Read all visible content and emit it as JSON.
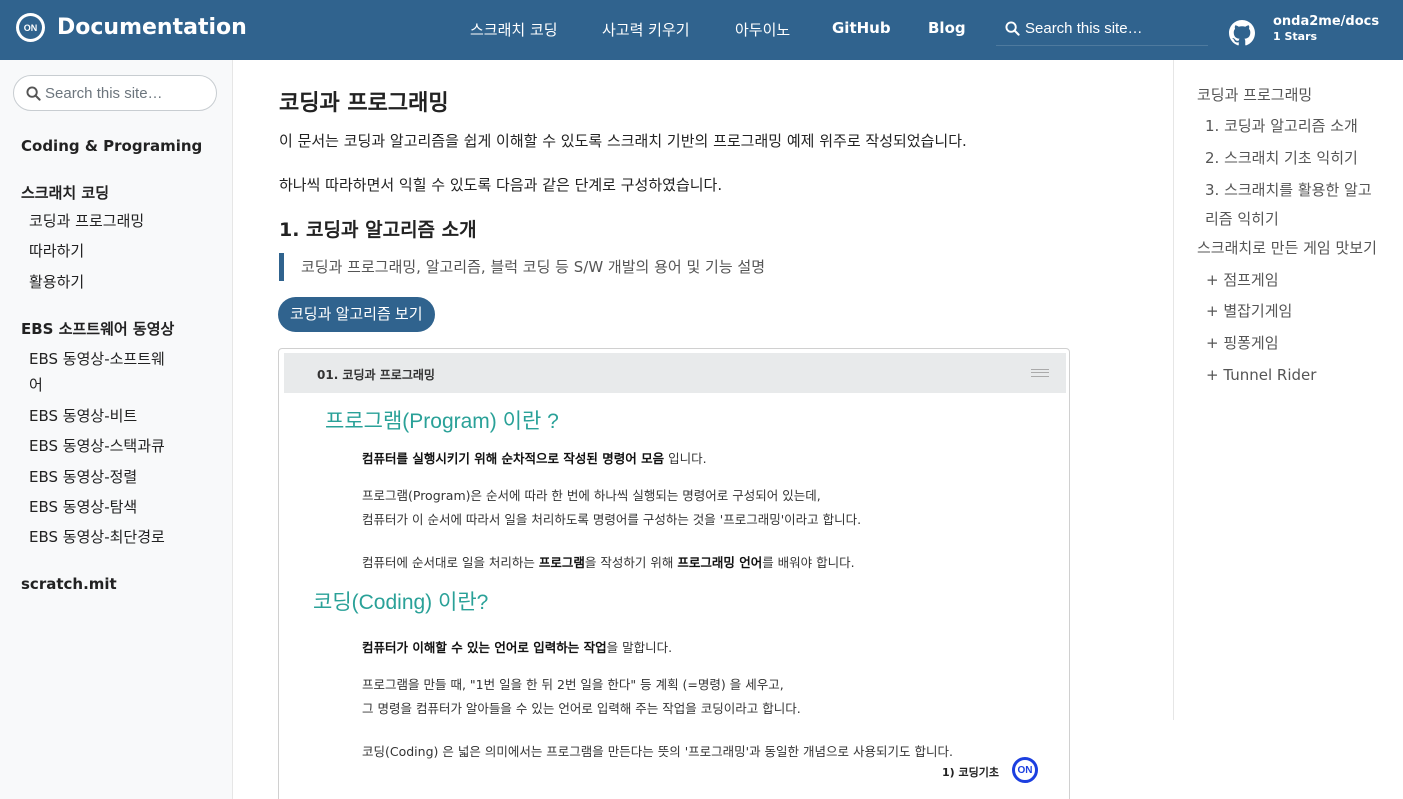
{
  "header": {
    "logo_text": "ON",
    "title": "Documentation",
    "nav": [
      "스크래치 코딩",
      "사고력 키우기",
      "아두이노",
      "GitHub",
      "Blog"
    ],
    "search_placeholder": "Search this site…",
    "repo_name": "onda2me/docs",
    "repo_stars": "1 Stars"
  },
  "sidebar": {
    "search_placeholder": "Search this site…",
    "sections": [
      {
        "title": "Coding & Programing",
        "items": []
      },
      {
        "title": "스크래치 코딩",
        "items": [
          "코딩과 프로그래밍",
          "따라하기",
          "활용하기"
        ]
      },
      {
        "title": "EBS 소프트웨어 동영상",
        "items": [
          "EBS 동영상-소프트웨어",
          "EBS 동영상-비트",
          "EBS 동영상-스택과큐",
          "EBS 동영상-정렬",
          "EBS 동영상-탐색",
          "EBS 동영상-최단경로"
        ]
      },
      {
        "title": "scratch.mit",
        "items": []
      }
    ],
    "long_item_line1": "EBS 동영상-소프트웨",
    "long_item_line2": "어"
  },
  "main": {
    "title": "코딩과 프로그래밍",
    "intro": "이 문서는 코딩과 알고리즘을 쉽게 이해할 수 있도록 스크래치 기반의 프로그래밍 예제 위주로 작성되었습니다.",
    "intro2": "하나씩 따라하면서 익힐 수 있도록 다음과 같은 단계로 구성하였습니다.",
    "section_title": "1. 코딩과 알고리즘 소개",
    "quote": "코딩과 프로그래밍, 알고리즘, 블럭 코딩 등 S/W 개발의 용어 및 기능 설명",
    "button": "코딩과 알고리즘 보기",
    "doc": {
      "header": "01. 코딩과 프로그래밍",
      "h1": "프로그램(Program) 이란 ?",
      "p1_bold": "컴퓨터를 실행시키기 위해 순차적으로 작성된 명령어 모음",
      "p1_rest": " 입니다.",
      "p2": "프로그램(Program)은 순서에 따라 한 번에 하나씩 실행되는 명령어로 구성되어 있는데,",
      "p3": "컴퓨터가 이 순서에 따라서 일을 처리하도록 명령어를 구성하는 것을 '프로그래밍'이라고 합니다.",
      "p4_a": "컴퓨터에 순서대로 일을 처리하는 ",
      "p4_b": "프로그램",
      "p4_c": "을 작성하기 위해 ",
      "p4_d": "프로그래밍 언어",
      "p4_e": "를 배워야 합니다.",
      "h2": "코딩(Coding) 이란?",
      "p5_bold": "컴퓨터가 이해할 수 있는 언어로 입력하는 작업",
      "p5_rest": "을 말합니다.",
      "p6": "프로그램을 만들 때, \"1번 일을 한 뒤 2번 일을 한다\" 등 계획 (=명령) 을 세우고,",
      "p7": "그 명령을 컴퓨터가 알아들을 수 있는 언어로 입력해 주는 작업을 코딩이라고 합니다.",
      "p8": "코딩(Coding) 은 넓은 의미에서는 프로그램을 만든다는 뜻의 '프로그래밍'과 동일한 개념으로 사용되기도 합니다.",
      "footer": "1) 코딩기초",
      "footer_logo": "ON"
    }
  },
  "toc": {
    "title": "코딩과 프로그래밍",
    "items": [
      "1. 코딩과 알고리즘 소개",
      "2. 스크래치 기초 익히기"
    ],
    "item3_line1": "3. 스크래치를 활용한 알고",
    "item3_line2": "리즘 익히기",
    "section2": "스크래치로 만든 게임 맛보기",
    "games": [
      "+ 점프게임",
      "+ 별잡기게임",
      "+ 핑퐁게임",
      "+ Tunnel Rider"
    ]
  },
  "colors": {
    "primary": "#30638e",
    "accent_teal": "#2aa198",
    "sidebar_bg": "#f8f9fa"
  }
}
